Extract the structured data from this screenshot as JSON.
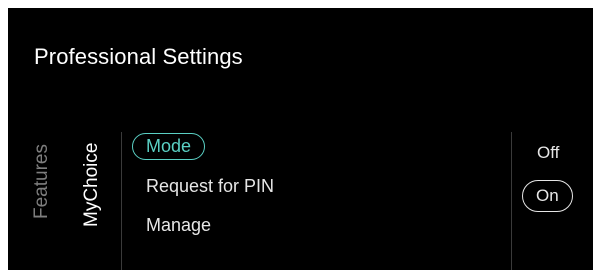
{
  "header": {
    "title": "Professional Settings"
  },
  "tabs": [
    {
      "label": "Features",
      "active": false
    },
    {
      "label": "MyChoice",
      "active": true
    }
  ],
  "menu": {
    "items": [
      {
        "label": "Mode",
        "focused": true
      },
      {
        "label": "Request for PIN",
        "focused": false
      },
      {
        "label": "Manage",
        "focused": false
      }
    ]
  },
  "options": {
    "items": [
      {
        "label": "Off",
        "selected": false
      },
      {
        "label": "On",
        "selected": true
      }
    ]
  },
  "colors": {
    "background": "#000000",
    "focus_accent": "#5ad0c4",
    "text": "#e6e6e6",
    "inactive_tab": "#7e7e7e"
  }
}
